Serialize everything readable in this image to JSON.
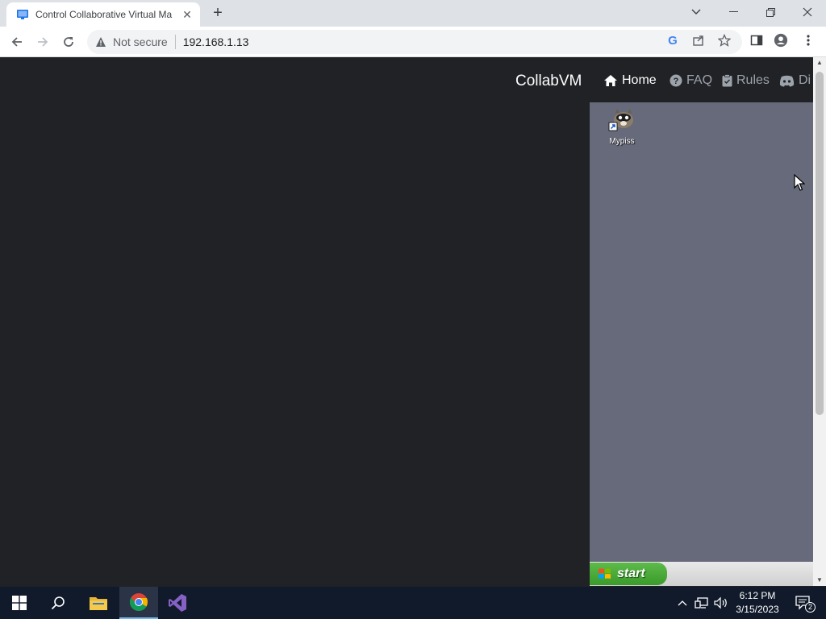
{
  "browser": {
    "tab_title": "Control Collaborative Virtual Ma",
    "security_label": "Not secure",
    "url": "192.168.1.13"
  },
  "site": {
    "brand": "CollabVM",
    "nav": [
      {
        "label": "Home",
        "icon": "home-icon",
        "active": true
      },
      {
        "label": "FAQ",
        "icon": "question-icon",
        "active": false
      },
      {
        "label": "Rules",
        "icon": "clipboard-icon",
        "active": false
      },
      {
        "label": "Di",
        "icon": "discord-icon",
        "active": false
      }
    ]
  },
  "vm": {
    "desktop_icon_label": "Mypiss",
    "start_label": "start"
  },
  "windows_taskbar": {
    "time": "6:12 PM",
    "date": "3/15/2023",
    "notification_count": "2"
  },
  "colors": {
    "page_bg": "#202226",
    "vm_desktop": "#676a7a",
    "xp_start_green": "#3a9a2a",
    "taskbar": "#101a2b"
  }
}
